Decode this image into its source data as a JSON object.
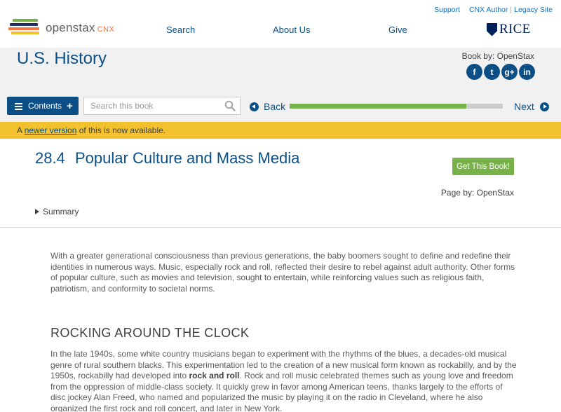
{
  "header": {
    "logo_text": "openstax",
    "logo_sub": "CNX",
    "util_links": {
      "support": "Support",
      "cnx_author": "CNX Author",
      "separator": "|",
      "legacy": "Legacy Site"
    },
    "nav": {
      "search": "Search",
      "about": "About Us",
      "give": "Give"
    },
    "partner_logo": "RICE"
  },
  "book": {
    "title": "U.S. History",
    "book_by": "Book by: OpenStax",
    "social": [
      {
        "icon": "facebook-icon",
        "glyph": "f"
      },
      {
        "icon": "twitter-icon",
        "glyph": "t"
      },
      {
        "icon": "google-plus-icon",
        "glyph": "g+"
      },
      {
        "icon": "linkedin-icon",
        "glyph": "in"
      }
    ]
  },
  "toolbar": {
    "contents_label": "Contents",
    "contents_plus": "+",
    "search_placeholder": "Search this book",
    "back_label": "Back",
    "next_label": "Next",
    "progress_fraction": 0.83
  },
  "notice": {
    "prefix": "A ",
    "link": "newer version",
    "suffix": " of this is now available."
  },
  "page": {
    "section_number": "28.4",
    "section_title": "Popular Culture and Mass Media",
    "get_book": "Get This Book!",
    "page_by": "Page by: OpenStax",
    "summary": "Summary"
  },
  "content": {
    "intro": "With a greater generational consciousness than previous generations, the baby boomers sought to define and redefine their identities in numerous ways. Music, especially rock and roll, reflected their desire to rebel against adult authority. Other forms of popular culture, such as movies and television, sought to entertain, while reinforcing values such as religious faith, patriotism, and conformity to societal norms.",
    "heading": "ROCKING AROUND THE CLOCK",
    "body_1": "In the late 1940s, some white country musicians began to experiment with the rhythms of the blues, a decades-old musical genre of rural southern blacks. This experimentation led to the creation of a new musical form known as rockabilly, and by the 1950s, rockabilly had developed into ",
    "body_bold": "rock and roll",
    "body_2": ". Rock and roll music celebrated themes such as young love and freedom from the oppression of middle-class society. It quickly grew in favor among American teens, thanks largely to the efforts of disc jockey Alan Freed, who named and popularized the music by playing it on the radio in Cleveland, where he also organized the first rock and roll concert, and later in New York."
  },
  "colors": {
    "brand_blue": "#0c4f86",
    "link_blue": "#0f6fbf",
    "green": "#78b04a",
    "notice_yellow": "#f2c12e",
    "band_gray": "#f1f1f1",
    "logo_orange": "#f47641"
  }
}
